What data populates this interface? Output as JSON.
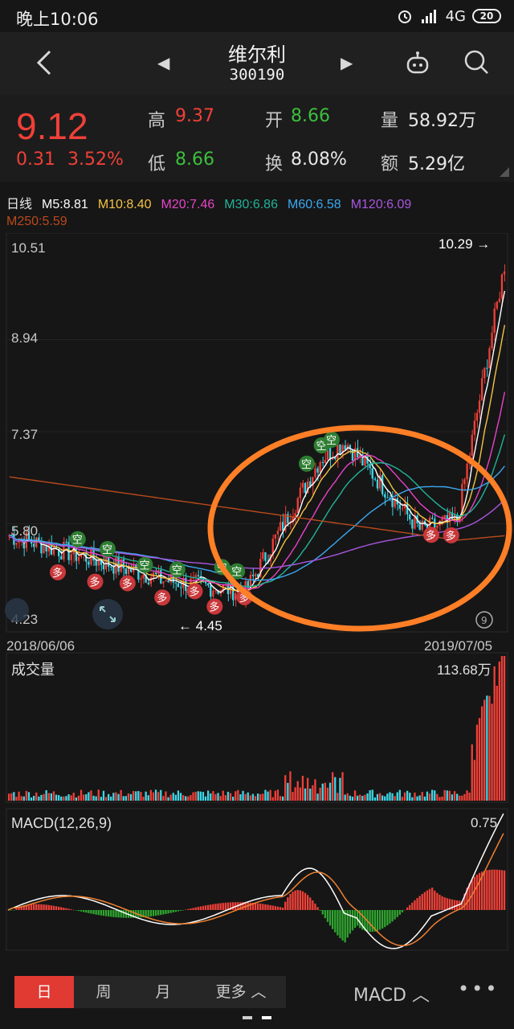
{
  "status": {
    "time": "晚上10:06",
    "network": "4G",
    "battery": "20"
  },
  "nav": {
    "stock_name": "维尔利",
    "stock_code": "300190"
  },
  "quote": {
    "price": "9.12",
    "change": "0.31",
    "change_pct": "3.52%",
    "high_label": "高",
    "high": "9.37",
    "low_label": "低",
    "low": "8.66",
    "open_label": "开",
    "open": "8.66",
    "turnover_label": "换",
    "turnover": "8.08%",
    "volume_label": "量",
    "volume": "58.92万",
    "amount_label": "额",
    "amount": "5.29亿"
  },
  "ma": {
    "period": "日线",
    "m5": "M5:8.81",
    "m10": "M10:8.40",
    "m20": "M20:7.46",
    "m30": "M30:6.86",
    "m60": "M60:6.58",
    "m120": "M120:6.09",
    "m250": "M250:5.59"
  },
  "colors": {
    "m5": "#ffffff",
    "m10": "#f5c342",
    "m20": "#e843c8",
    "m30": "#22b39a",
    "m60": "#3ba8f0",
    "m120": "#a956e0",
    "m250": "#b84a1c",
    "up": "#f04038",
    "down": "#3fd6e6",
    "annotation": "#ff7f27"
  },
  "price_chart": {
    "y_ticks": [
      "10.51",
      "8.94",
      "7.37",
      "5.80",
      "4.23"
    ],
    "max_marker": "10.29",
    "min_marker": "4.45",
    "start_date": "2018/06/06",
    "end_date": "2019/07/05",
    "buy_signal": "多",
    "sell_signal": "空"
  },
  "volume_chart": {
    "title": "成交量",
    "max_label": "113.68万"
  },
  "macd_chart": {
    "title": "MACD(12,26,9)",
    "max_label": "0.75"
  },
  "tabs": {
    "day": "日",
    "week": "周",
    "month": "月",
    "more": "更多 ︿",
    "indicator": "MACD ︿",
    "more_menu": "•••"
  }
}
